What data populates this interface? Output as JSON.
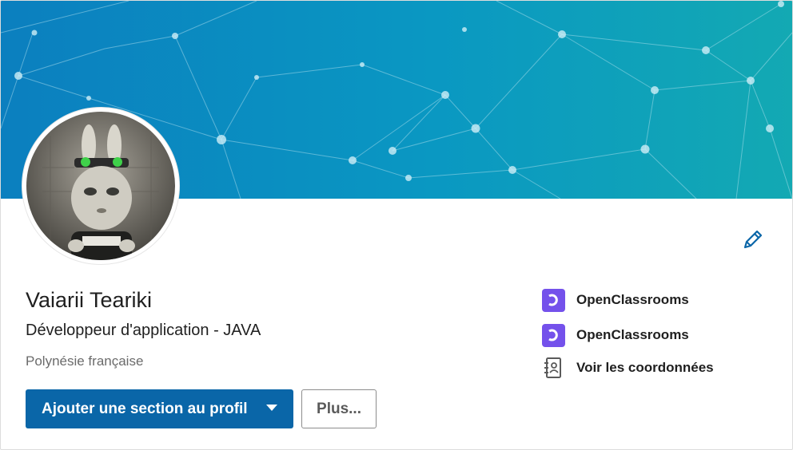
{
  "profile": {
    "name": "Vaiarii Teariki",
    "headline": "Développeur d'application - JAVA",
    "location": "Polynésie française"
  },
  "actions": {
    "primary_label": "Ajouter une section au profil",
    "secondary_label": "Plus..."
  },
  "side_links": [
    {
      "label": "OpenClassrooms",
      "icon": "openclassrooms-logo"
    },
    {
      "label": "OpenClassrooms",
      "icon": "openclassrooms-logo"
    },
    {
      "label": "Voir les coordonnées",
      "icon": "contact-card-icon"
    }
  ],
  "colors": {
    "banner_left": "#0b7fbf",
    "banner_right": "#12a8b4",
    "primary_button": "#0a66a8",
    "edit_icon": "#0a66a8",
    "openclassrooms": "#7451eb"
  },
  "icons": {
    "edit": "pencil-icon",
    "caret": "chevron-down-icon"
  }
}
